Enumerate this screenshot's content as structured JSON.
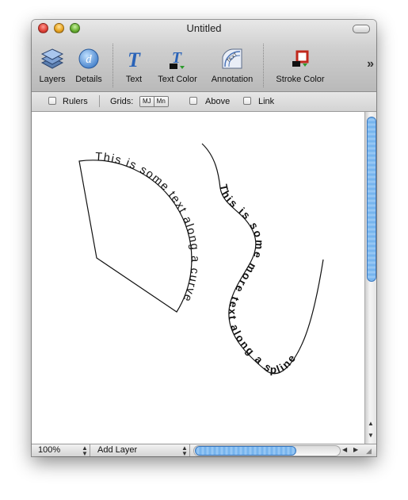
{
  "window": {
    "title": "Untitled"
  },
  "toolbar": {
    "items": [
      {
        "label": "Layers",
        "icon": "layers-icon"
      },
      {
        "label": "Details",
        "icon": "details-icon"
      },
      {
        "label": "Text",
        "icon": "text-icon"
      },
      {
        "label": "Text Color",
        "icon": "text-color-icon"
      },
      {
        "label": "Annotation",
        "icon": "annotation-icon"
      },
      {
        "label": "Stroke Color",
        "icon": "stroke-color-icon"
      }
    ],
    "overflow": "»"
  },
  "options": {
    "rulers": {
      "label": "Rulers",
      "checked": false
    },
    "grids_label": "Grids:",
    "grid_buttons": [
      "MJ",
      "Mn"
    ],
    "above": {
      "label": "Above",
      "checked": false
    },
    "link": {
      "label": "Link",
      "checked": false
    }
  },
  "canvas": {
    "curve_text": "This is some text along a curve",
    "spline_text": "This is some more text along a spline"
  },
  "status": {
    "zoom": "100%",
    "layer_select": "Add Layer"
  },
  "colors": {
    "accent": "#6fb0ec",
    "details_icon": "#4a86d4",
    "text_icon": "#2a63b8",
    "stroke_icon": "#c0281c"
  }
}
